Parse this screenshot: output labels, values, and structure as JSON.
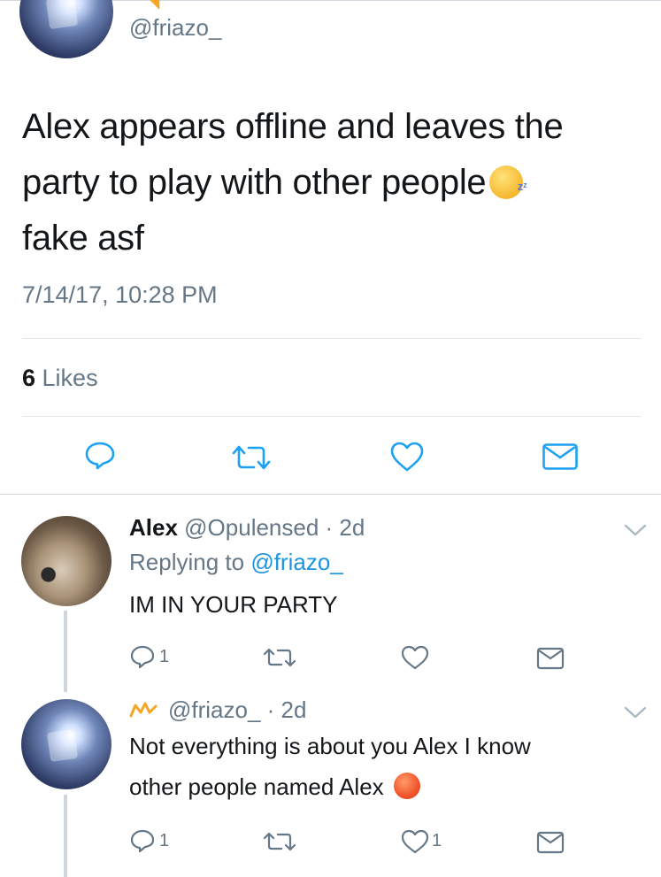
{
  "main_tweet": {
    "handle": "@friazo_",
    "text_line1": "Alex appears offline and leaves the",
    "text_line2": "party to play with other people",
    "text_line3": "fake asf",
    "emoji": "sleeping-face-emoji",
    "timestamp": "7/14/17, 10:28 PM",
    "likes_count": "6",
    "likes_label": " Likes"
  },
  "replies": [
    {
      "name": "Alex",
      "handle": "@Opulensed",
      "time": " · 2d",
      "replying_prefix": "Replying to ",
      "replying_handle": "@friazo_",
      "text": "IM IN YOUR PARTY",
      "reply_count": "1",
      "like_count": ""
    },
    {
      "handle": "@friazo_",
      "time": " · 2d",
      "text_line1": "Not everything is about you Alex I know",
      "text_line2": "other people named Alex",
      "emoji": "angry-face-emoji",
      "reply_count": "1",
      "like_count": "1"
    }
  ],
  "colors": {
    "text": "#14171a",
    "muted": "#657786",
    "link": "#1b95e0",
    "icon": "#1da1f2",
    "icon_gray": "#657786"
  }
}
